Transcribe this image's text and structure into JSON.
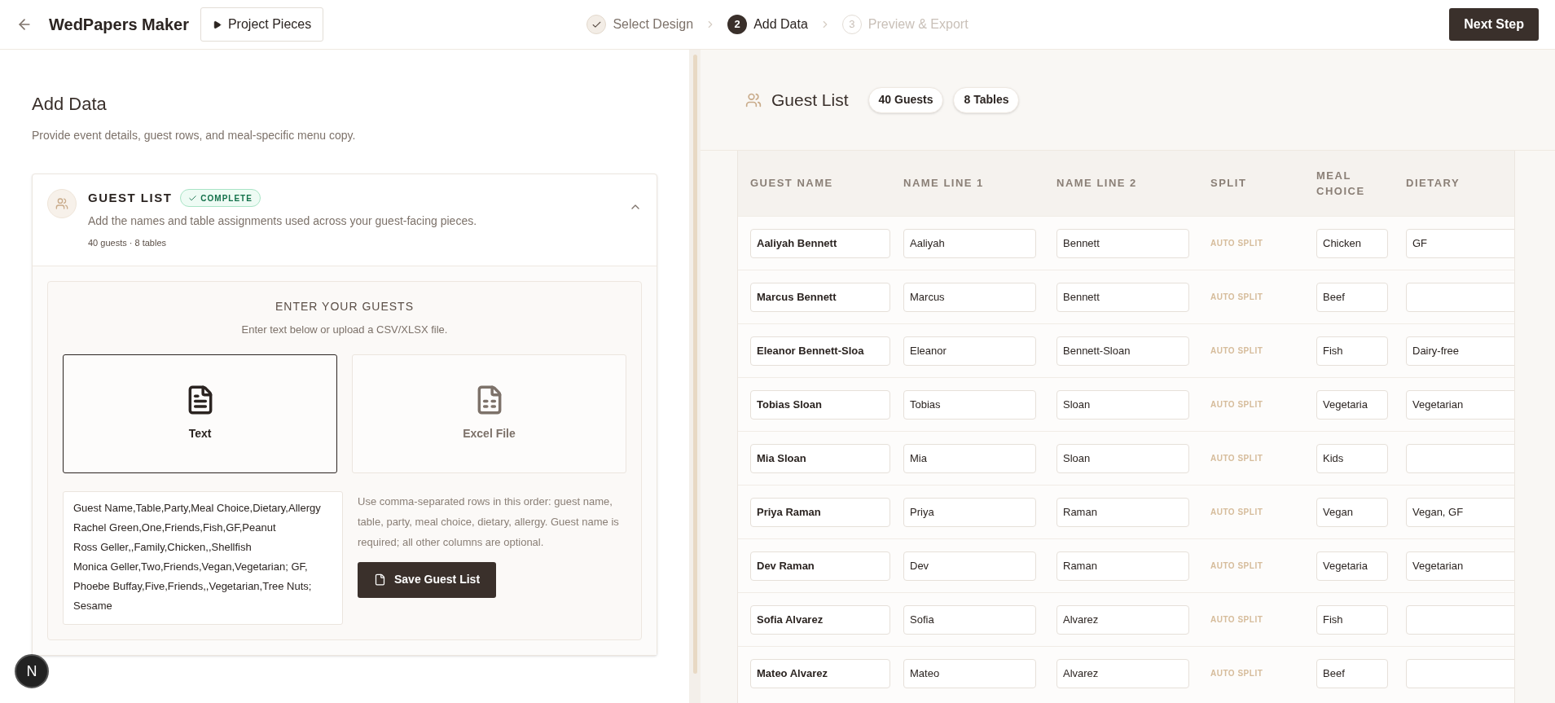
{
  "header": {
    "title": "WedPapers Maker",
    "project_button": "Project Pieces",
    "next_button": "Next Step",
    "steps": [
      {
        "label": "Select Design",
        "done": true,
        "selected": false
      },
      {
        "number": "2",
        "label": "Add Data",
        "done": false,
        "selected": true
      },
      {
        "number": "3",
        "label": "Preview & Export",
        "done": false,
        "selected": false
      }
    ]
  },
  "left": {
    "title": "Add Data",
    "subtitle": "Provide event details, guest rows, and meal-specific menu copy.",
    "section": {
      "title": "GUEST LIST",
      "badge": "COMPLETE",
      "complete": true,
      "expanded": true,
      "description": "Add the names and table assignments used across your guest-facing pieces.",
      "summary": "40 guests · 8 tables",
      "entry": {
        "title": "ENTER YOUR GUESTS",
        "subtitle": "Enter text below or upload a CSV/XLSX file.",
        "modes": [
          {
            "kind": "text",
            "label": "Text",
            "selected": true
          },
          {
            "kind": "excel",
            "label": "Excel File",
            "selected": false
          }
        ],
        "textarea": "Guest Name,Table,Party,Meal Choice,Dietary,Allergy\nRachel Green,One,Friends,Fish,GF,Peanut\nRoss Geller,,Family,Chicken,,Shellfish\nMonica Geller,Two,Friends,Vegan,Vegetarian; GF,\nPhoebe Buffay,Five,Friends,,Vegetarian,Tree Nuts; Sesame",
        "help": "Use comma-separated rows in this order: guest name, table, party, meal choice, dietary, allergy. Guest name is required; all other columns are optional.",
        "save_button": "Save Guest List"
      }
    }
  },
  "right": {
    "title": "Guest List",
    "chips": [
      "40 Guests",
      "8 Tables"
    ],
    "table": {
      "columns": [
        "GUEST NAME",
        "NAME LINE 1",
        "NAME LINE 2",
        "SPLIT",
        "MEAL CHOICE",
        "DIETARY"
      ],
      "rows": [
        {
          "guest_name": "Aaliyah Bennett",
          "name_line_1": "Aaliyah",
          "name_line_2": "Bennett",
          "split": "AUTO SPLIT",
          "meal": "Chicken",
          "dietary": "GF"
        },
        {
          "guest_name": "Marcus Bennett",
          "name_line_1": "Marcus",
          "name_line_2": "Bennett",
          "split": "AUTO SPLIT",
          "meal": "Beef"
        },
        {
          "guest_name": "Eleanor Bennett-Sloa",
          "name_line_1": "Eleanor",
          "name_line_2": "Bennett-Sloan",
          "split": "AUTO SPLIT",
          "meal": "Fish",
          "dietary": "Dairy-free"
        },
        {
          "guest_name": "Tobias Sloan",
          "name_line_1": "Tobias",
          "name_line_2": "Sloan",
          "split": "AUTO SPLIT",
          "meal": "Vegetaria",
          "dietary": "Vegetarian"
        },
        {
          "guest_name": "Mia Sloan",
          "name_line_1": "Mia",
          "name_line_2": "Sloan",
          "split": "AUTO SPLIT",
          "meal": "Kids"
        },
        {
          "guest_name": "Priya Raman",
          "name_line_1": "Priya",
          "name_line_2": "Raman",
          "split": "AUTO SPLIT",
          "meal": "Vegan",
          "dietary": "Vegan, GF"
        },
        {
          "guest_name": "Dev Raman",
          "name_line_1": "Dev",
          "name_line_2": "Raman",
          "split": "AUTO SPLIT",
          "meal": "Vegetaria",
          "dietary": "Vegetarian"
        },
        {
          "guest_name": "Sofia Alvarez",
          "name_line_1": "Sofia",
          "name_line_2": "Alvarez",
          "split": "AUTO SPLIT",
          "meal": "Fish"
        },
        {
          "guest_name": "Mateo Alvarez",
          "name_line_1": "Mateo",
          "name_line_2": "Alvarez",
          "split": "AUTO SPLIT",
          "meal": "Beef"
        }
      ]
    }
  },
  "dev_badge": {
    "label": "N"
  }
}
